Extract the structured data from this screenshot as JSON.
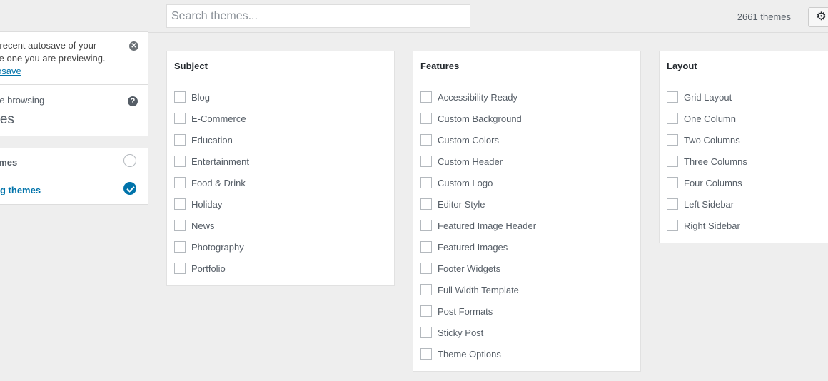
{
  "sidebar": {
    "notice": {
      "line1": "ore recent autosave of your",
      "line2": "n the one you are previewing.",
      "link": "autosave",
      "dismiss_glyph": "✕"
    },
    "browsing": {
      "label": "re browsing",
      "title": "mes",
      "help_glyph": "?"
    },
    "sources": [
      {
        "label": "emes",
        "checked": false
      },
      {
        "label": "org themes",
        "checked": true
      }
    ]
  },
  "topbar": {
    "search_placeholder": "Search themes...",
    "count": "2661 themes",
    "filter_icon": "gear-icon",
    "gear_glyph": "⚙"
  },
  "filters": {
    "subject": {
      "title": "Subject",
      "options": [
        "Blog",
        "E-Commerce",
        "Education",
        "Entertainment",
        "Food & Drink",
        "Holiday",
        "News",
        "Photography",
        "Portfolio"
      ]
    },
    "features": {
      "title": "Features",
      "options": [
        "Accessibility Ready",
        "Custom Background",
        "Custom Colors",
        "Custom Header",
        "Custom Logo",
        "Editor Style",
        "Featured Image Header",
        "Featured Images",
        "Footer Widgets",
        "Full Width Template",
        "Post Formats",
        "Sticky Post",
        "Theme Options"
      ]
    },
    "layout": {
      "title": "Layout",
      "options": [
        "Grid Layout",
        "One Column",
        "Two Columns",
        "Three Columns",
        "Four Columns",
        "Left Sidebar",
        "Right Sidebar"
      ]
    }
  },
  "colors": {
    "accent": "#0073aa",
    "background": "#eeeeee"
  }
}
